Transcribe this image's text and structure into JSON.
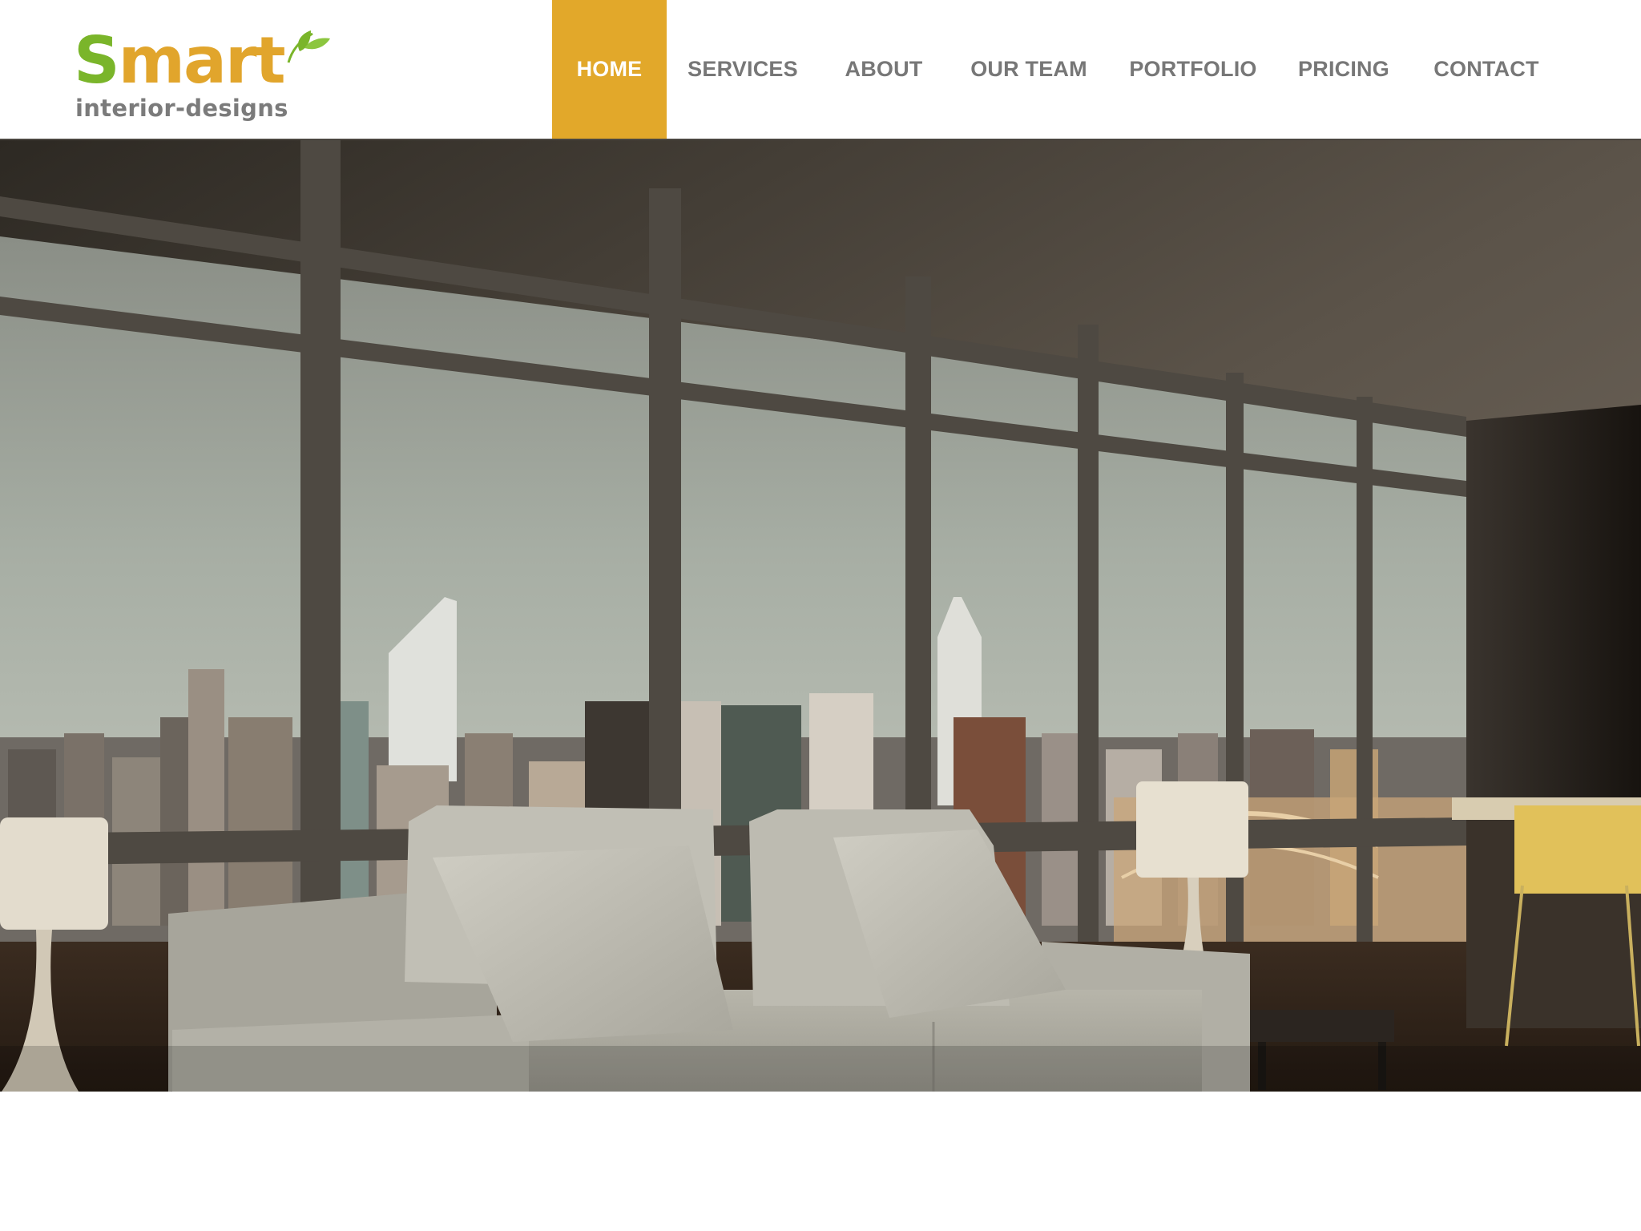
{
  "brand": {
    "name_first_letter": "S",
    "name_rest": "mart",
    "tagline": "interior-designs",
    "colors": {
      "green": "#7ab52a",
      "orange": "#e1a52c",
      "gray": "#7b7b7b"
    },
    "icon": "leaf-icon"
  },
  "nav": {
    "active_color": "#e2a82a",
    "items": [
      {
        "label": "HOME",
        "active": true
      },
      {
        "label": "SERVICES",
        "active": false
      },
      {
        "label": "ABOUT",
        "active": false
      },
      {
        "label": "OUR TEAM",
        "active": false
      },
      {
        "label": "PORTFOLIO",
        "active": false
      },
      {
        "label": "PRICING",
        "active": false
      },
      {
        "label": "CONTACT",
        "active": false
      }
    ]
  },
  "hero": {
    "image": "living-room-city-view"
  }
}
